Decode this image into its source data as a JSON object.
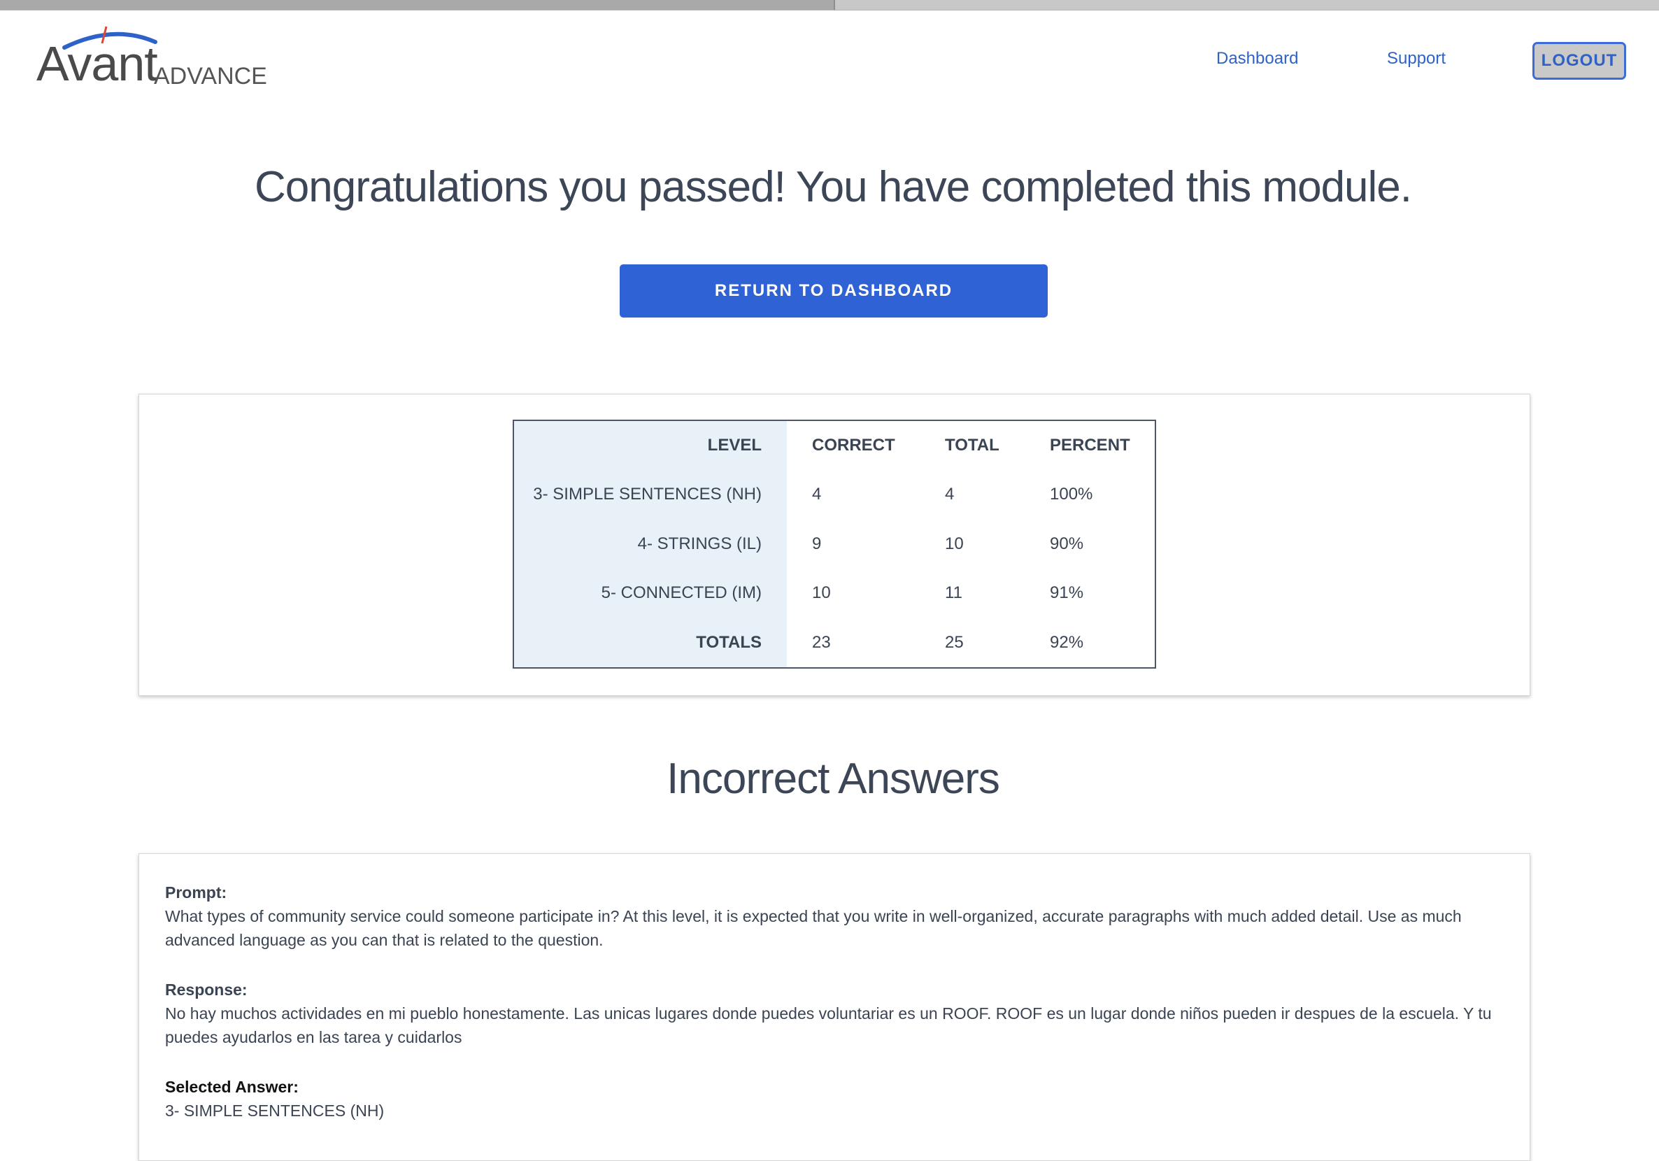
{
  "header": {
    "brand_main": "Avant",
    "brand_sub": "ADVANCE",
    "nav": {
      "dashboard": "Dashboard",
      "support": "Support"
    },
    "logout_label": "LOGOUT"
  },
  "main": {
    "congrats_text": "Congratulations you passed! You have completed this module.",
    "return_button": "RETURN TO DASHBOARD"
  },
  "results": {
    "headers": {
      "level": "LEVEL",
      "correct": "CORRECT",
      "total": "TOTAL",
      "percent": "PERCENT"
    },
    "rows": [
      {
        "level": "3- SIMPLE SENTENCES (NH)",
        "correct": "4",
        "total": "4",
        "percent": "100%"
      },
      {
        "level": "4- STRINGS (IL)",
        "correct": "9",
        "total": "10",
        "percent": "90%"
      },
      {
        "level": "5- CONNECTED (IM)",
        "correct": "10",
        "total": "11",
        "percent": "91%"
      }
    ],
    "totals": {
      "level": "TOTALS",
      "correct": "23",
      "total": "25",
      "percent": "92%"
    }
  },
  "incorrect": {
    "heading": "Incorrect Answers",
    "items": [
      {
        "prompt_label": "Prompt:",
        "prompt": "What types of community service could someone participate in? At this level, it is expected that you write in well-organized, accurate paragraphs with much added detail. Use as much advanced language as you can that is related to the question.",
        "response_label": "Response:",
        "response": "No hay muchos actividades en mi pueblo honestamente. Las unicas lugares donde puedes voluntariar es un ROOF. ROOF es un lugar donde niños pueden ir despues de la escuela. Y tu puedes ayudarlos en las tarea y cuidarlos",
        "selected_label": "Selected Answer:",
        "selected": "3- SIMPLE SENTENCES (NH)"
      }
    ]
  },
  "colors": {
    "accent": "#2f62d4",
    "link": "#2f62c8",
    "table_shade": "#e8f0f8",
    "logo_arc": "#2f62c8",
    "logo_tick": "#d9473a"
  }
}
